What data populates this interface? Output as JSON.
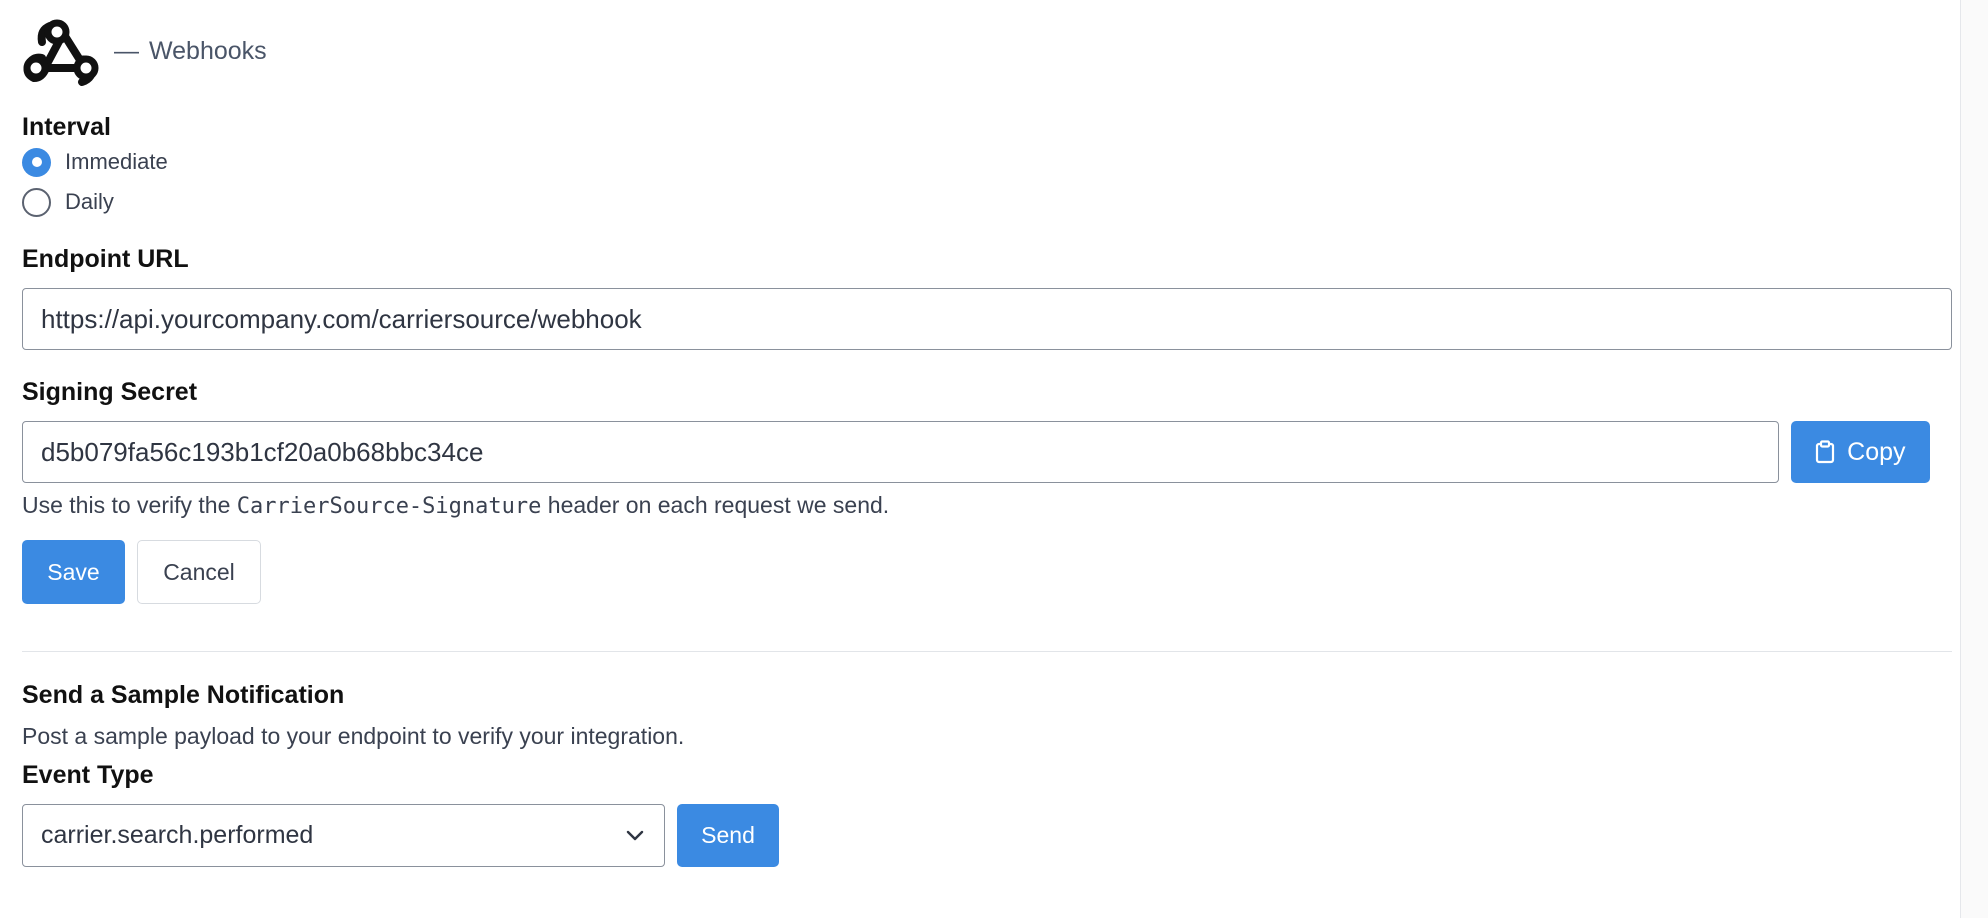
{
  "header": {
    "separator": "—",
    "title": "Webhooks",
    "logo_icon": "webhook-logo-icon"
  },
  "interval": {
    "label": "Interval",
    "options": [
      {
        "label": "Immediate",
        "selected": true
      },
      {
        "label": "Daily",
        "selected": false
      }
    ]
  },
  "endpoint": {
    "label": "Endpoint URL",
    "value": "https://api.yourcompany.com/carriersource/webhook"
  },
  "secret": {
    "label": "Signing Secret",
    "value": "d5b079fa56c193b1cf20a0b68bbc34ce",
    "copy_label": "Copy",
    "copy_icon": "clipboard-icon",
    "help_prefix": "Use this to verify the",
    "help_code": "CarrierSource-Signature",
    "help_suffix": "header on each request we send."
  },
  "actions": {
    "save_label": "Save",
    "cancel_label": "Cancel"
  },
  "sample": {
    "heading": "Send a Sample Notification",
    "description": "Post a sample payload to your endpoint to verify your integration.",
    "event_label": "Event Type",
    "event_selected": "carrier.search.performed",
    "send_label": "Send"
  },
  "colors": {
    "accent": "#3b8ae2",
    "text": "#2f3542"
  }
}
